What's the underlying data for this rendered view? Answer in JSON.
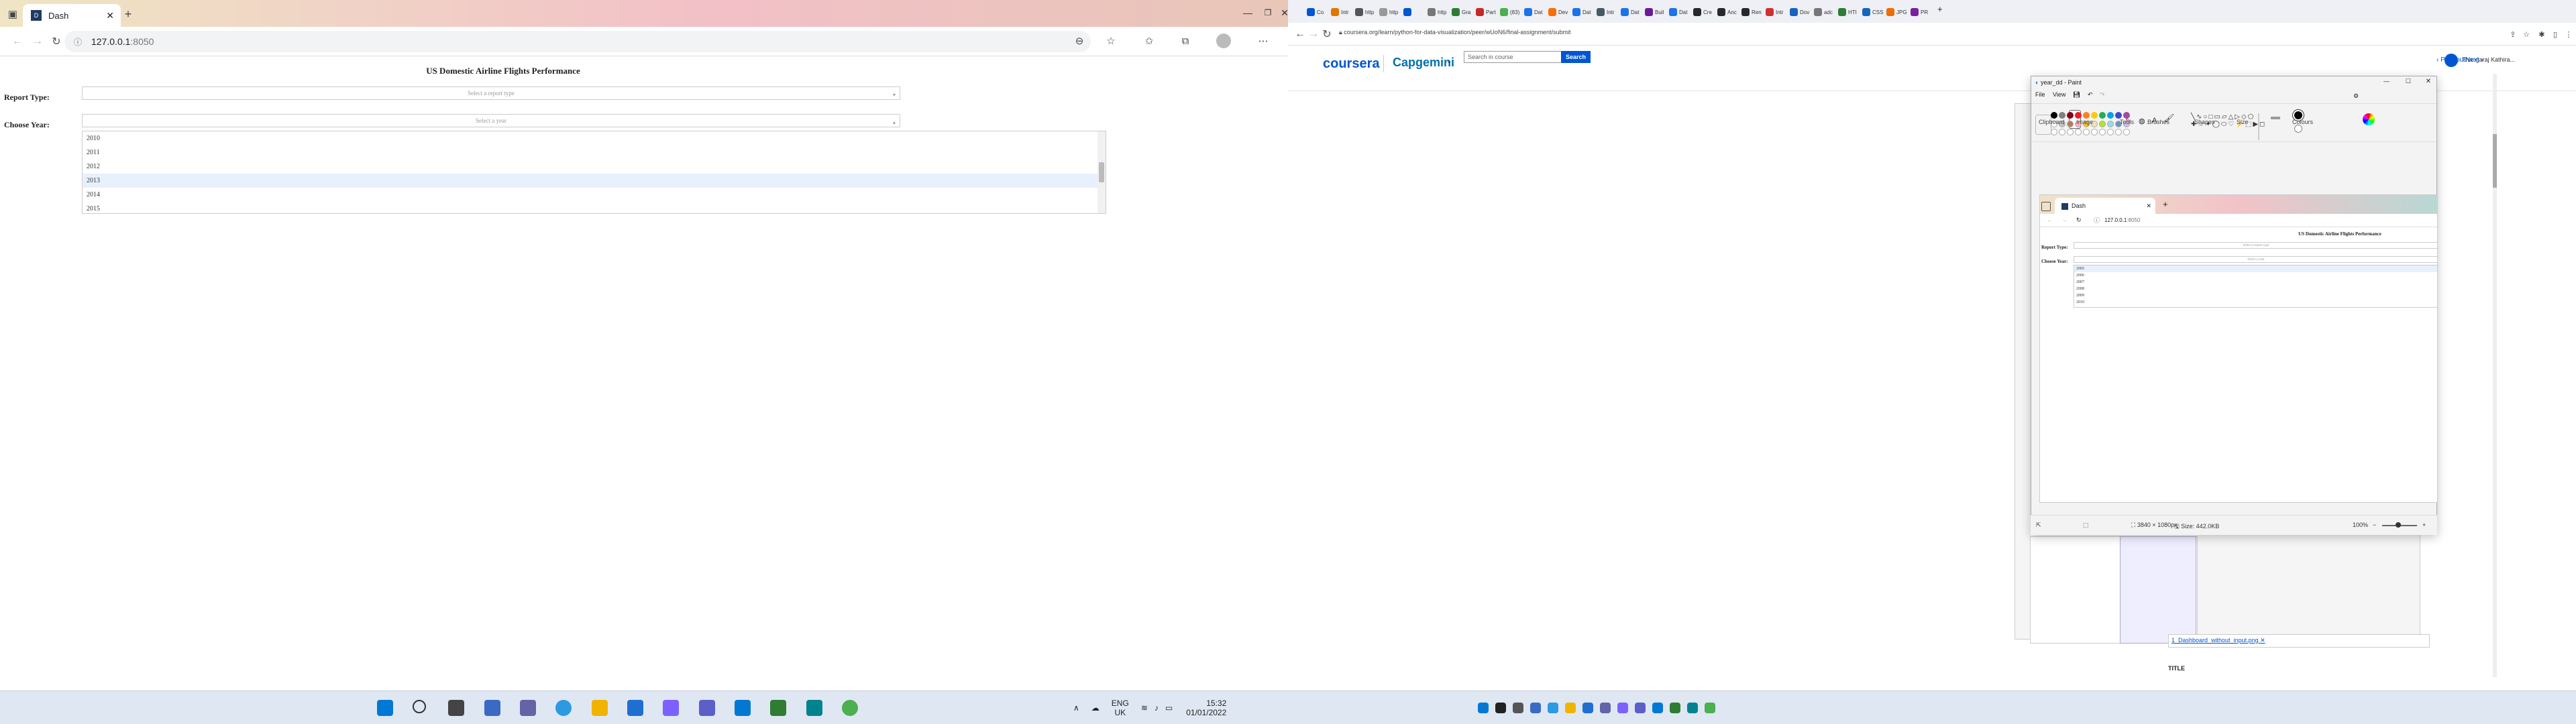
{
  "left": {
    "tab_title": "Dash",
    "tab_icon": "dash-icon",
    "url_host": "127.0.0.1",
    "url_port": ":8050",
    "dash_title": "US Domestic Airline Flights Performance",
    "report_label": "Report Type:",
    "report_placeholder": "Select a report type",
    "year_label": "Choose Year:",
    "year_placeholder": "Select a year",
    "year_options": [
      "2010",
      "2011",
      "2012",
      "2013",
      "2014",
      "2015"
    ],
    "year_highlighted": "2013",
    "taskbar": {
      "lang": "ENG",
      "region": "UK",
      "time": "15:32",
      "date": "01/01/2022"
    }
  },
  "right": {
    "url": "coursera.org/learn/python-for-data-visualization/peer/wUoN6/final-assignment/submit",
    "tabs": [
      "Co",
      "Intr",
      "http",
      "http",
      "",
      "http",
      "Gra",
      "Part",
      "(83)",
      "Dat",
      "Dev",
      "Dat",
      "Intr",
      "Dat",
      "Buil",
      "Dat",
      "Cre",
      "Anc",
      "Ren",
      "Intr",
      "Dov",
      "adc",
      "HTI",
      "CSS",
      "JPG",
      "PR"
    ],
    "coursera_logo": "coursera",
    "partner_logo": "Capgemini",
    "search_placeholder": "Search in course",
    "search_button": "Search",
    "user_name": "Thangaraj Kathira...",
    "prev": "Previous",
    "next": "Next",
    "paint": {
      "title": "year_dd - Paint",
      "menu": [
        "File",
        "View"
      ],
      "groups": [
        "Clipboard",
        "Image",
        "Tools",
        "Brushes",
        "Shapes",
        "Size",
        "Colours"
      ],
      "status_dims": "3840 × 1080px",
      "status_size": "Size: 442.0KB",
      "zoom": "100%",
      "inner": {
        "tab_title": "Dash",
        "url_host": "127.0.0.1",
        "url_port": ":8050",
        "dash_title": "US Domestic Airline Flights Performance",
        "report_label": "Report Type:",
        "report_placeholder": "Select a report type",
        "year_label": "Choose Year:",
        "year_placeholder": "Select a year",
        "year_options": [
          "2005",
          "2006",
          "2007",
          "2008",
          "2009",
          "2010"
        ]
      }
    },
    "file_link": "1_Dashboard_without_input.png",
    "title_label": "TITLE",
    "taskbar_colors": [
      "#0078d4",
      "#222",
      "#666",
      "#3b6ac4",
      "#2b9ae0",
      "#f0b400",
      "#1e6fd0",
      "#6264a7",
      "#7b61ff",
      "#0078d4",
      "#2e7d32",
      "#c62828"
    ]
  },
  "colors": {
    "accent": "#0056d2",
    "highlight": "#e8f0fe",
    "tabstrip_warm": "#f2c0c7"
  }
}
